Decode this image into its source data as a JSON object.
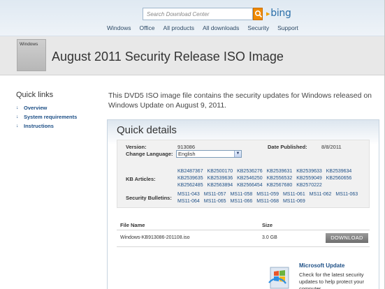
{
  "header": {
    "search_placeholder": "Search Download Center",
    "brand": "bing",
    "nav": [
      "Windows",
      "Office",
      "All products",
      "All downloads",
      "Security",
      "Support"
    ]
  },
  "title_band": {
    "thumb_label": "Windows",
    "page_title": "August 2011 Security Release ISO Image"
  },
  "quick_links": {
    "title": "Quick links",
    "items": [
      "Overview",
      "System requirements",
      "Instructions"
    ]
  },
  "description": "This DVD5 ISO image file contains the security updates for Windows released on Windows Update on August 9, 2011.",
  "quick_details": {
    "title": "Quick details",
    "version_label": "Version:",
    "version_value": "913086",
    "date_label": "Date Published:",
    "date_value": "8/8/2011",
    "language_label": "Change Language:",
    "language_value": "English",
    "kb_label": "KB Articles:",
    "kb_articles": [
      "KB2487367",
      "KB2500170",
      "KB2536276",
      "KB2539631",
      "KB2539633",
      "KB2539634",
      "KB2539635",
      "KB2539636",
      "KB2546250",
      "KB2556532",
      "KB2559049",
      "KB2560656",
      "KB2562485",
      "KB2563894",
      "KB2566454",
      "KB2567680",
      "KB2570222"
    ],
    "bulletins_label": "Security Bulletins:",
    "bulletins": [
      "MS11-043",
      "MS11-057",
      "MS11-058",
      "MS11-059",
      "MS11-061",
      "MS11-062",
      "MS11-063",
      "MS11-064",
      "MS11-065",
      "MS11-066",
      "MS11-068",
      "MS11-069"
    ]
  },
  "files": {
    "name_header": "File Name",
    "size_header": "Size",
    "file_name": "Windows-KB913086-201108.iso",
    "file_size": "3.0 GB",
    "download_label": "DOWNLOAD"
  },
  "microsoft_update": {
    "title": "Microsoft Update",
    "text": "Check for the latest security updates to help protect your computer."
  },
  "colors": {
    "link": "#1d4f86",
    "search_button": "#f08a00",
    "download_button": "#7f7f7f"
  }
}
